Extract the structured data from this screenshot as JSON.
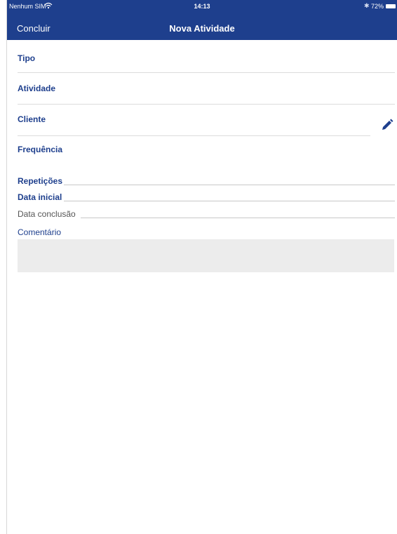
{
  "status_bar": {
    "carrier": "Nenhum SIM",
    "wifi_icon": "wifi-icon",
    "time": "14:13",
    "bluetooth_icon": "bluetooth-icon",
    "battery": "72%"
  },
  "nav": {
    "done_label": "Concluir",
    "title": "Nova Atividade"
  },
  "form": {
    "tipo_label": "Tipo",
    "atividade_label": "Atividade",
    "cliente_label": "Cliente",
    "frequencia_label": "Frequência",
    "repeticoes_label": "Repetições",
    "data_inicial_label": "Data inicial",
    "data_conclusao_label": "Data conclusão",
    "comentario_label": "Comentário",
    "edit_icon": "pencil-icon"
  },
  "colors": {
    "nav_background": "#1e3f8d",
    "label_color": "#1e3f8d",
    "comment_background": "#ececec"
  }
}
